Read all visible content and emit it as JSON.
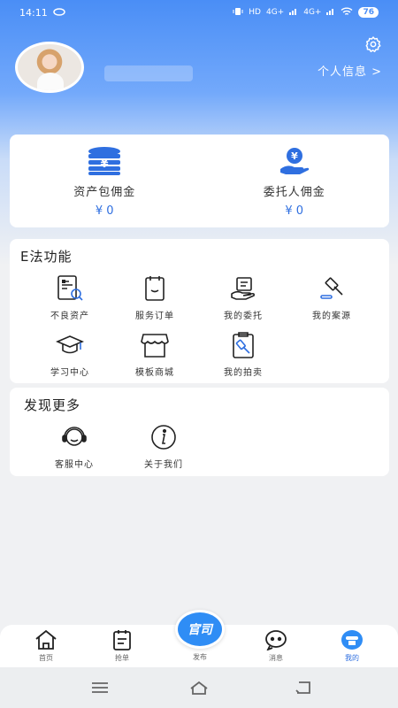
{
  "status_bar": {
    "time": "14:11",
    "battery": "76",
    "signal_1": "4G+",
    "signal_2": "4G+",
    "hd": "HD"
  },
  "profile": {
    "link_text": "个人信息 >"
  },
  "wallet": [
    {
      "label": "资产包佣金",
      "value": "¥ 0",
      "icon": "coins-stack-icon"
    },
    {
      "label": "委托人佣金",
      "value": "¥ 0",
      "icon": "hand-coin-icon"
    }
  ],
  "features": {
    "title": "E法功能",
    "items": [
      {
        "label": "不良资产",
        "icon": "document-search-icon"
      },
      {
        "label": "服务订单",
        "icon": "clipboard-icon"
      },
      {
        "label": "我的委托",
        "icon": "hand-document-icon"
      },
      {
        "label": "我的案源",
        "icon": "gavel-icon"
      },
      {
        "label": "学习中心",
        "icon": "graduation-cap-icon"
      },
      {
        "label": "模板商城",
        "icon": "storefront-icon"
      },
      {
        "label": "我的拍卖",
        "icon": "auction-board-icon"
      }
    ]
  },
  "discover": {
    "title": "发现更多",
    "items": [
      {
        "label": "客服中心",
        "icon": "headset-icon"
      },
      {
        "label": "关于我们",
        "icon": "info-icon"
      }
    ]
  },
  "bottom_nav": {
    "items": [
      {
        "label": "首页",
        "icon": "home-icon"
      },
      {
        "label": "抢单",
        "icon": "order-list-icon"
      },
      {
        "label": "消息",
        "icon": "chat-icon"
      },
      {
        "label": "我的",
        "icon": "profile-icon",
        "active": true
      }
    ],
    "fab_text": "官司",
    "fab_label": "发布"
  },
  "colors": {
    "accent": "#2f6fe0",
    "hero_top": "#4a8ef6",
    "fab": "#2f8df5"
  }
}
